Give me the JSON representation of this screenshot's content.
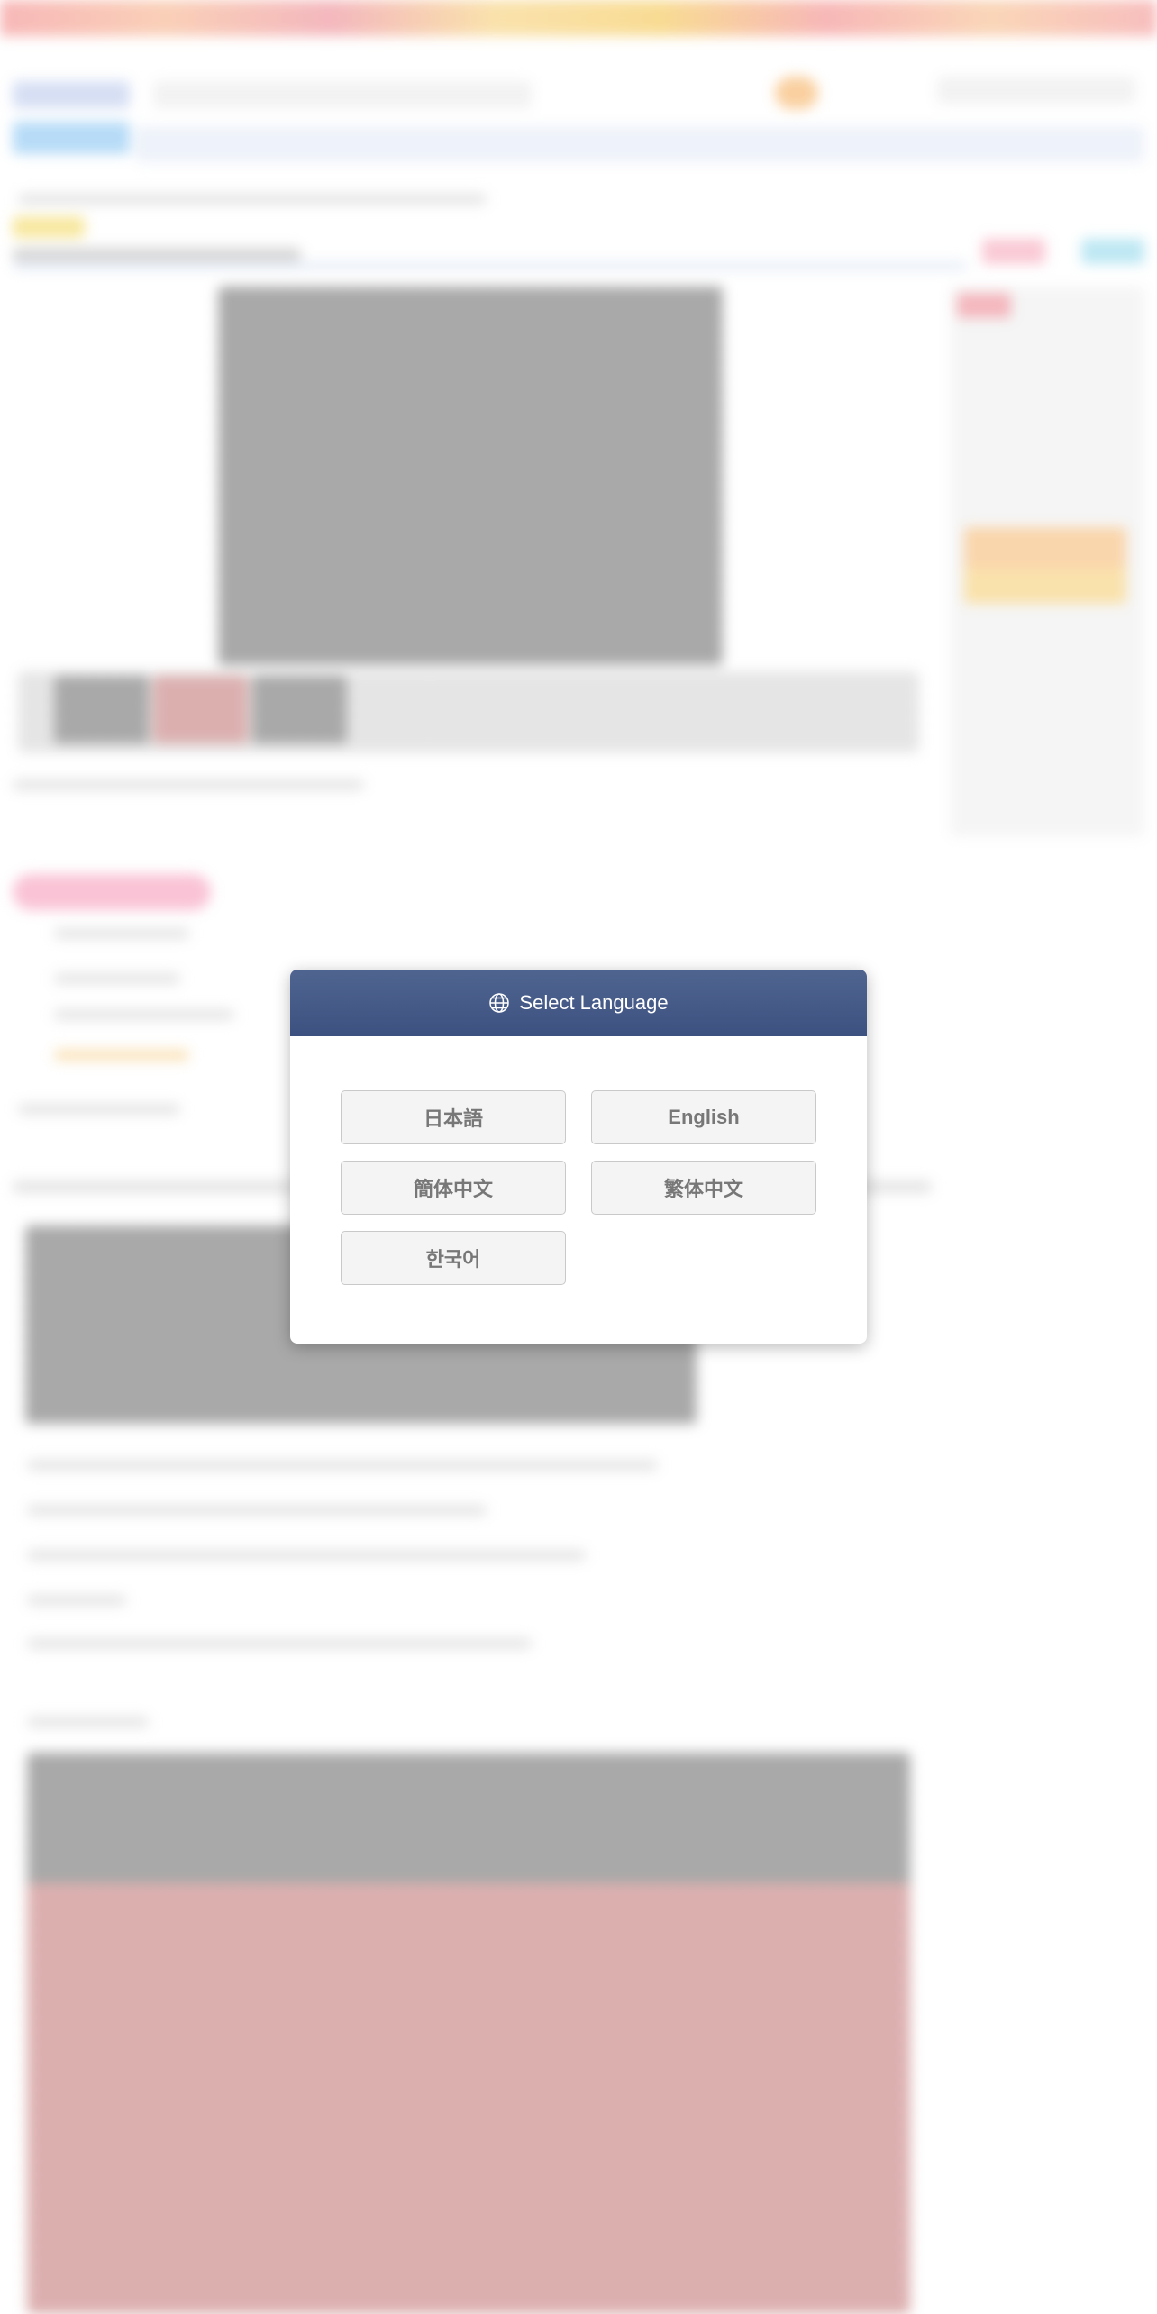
{
  "modal": {
    "title": "Select Language",
    "icon": "globe-icon",
    "header_color": "#46588a",
    "languages": [
      {
        "label": "日本語"
      },
      {
        "label": "English"
      },
      {
        "label": "簡体中文"
      },
      {
        "label": "繁体中文"
      },
      {
        "label": "한국어"
      }
    ]
  }
}
